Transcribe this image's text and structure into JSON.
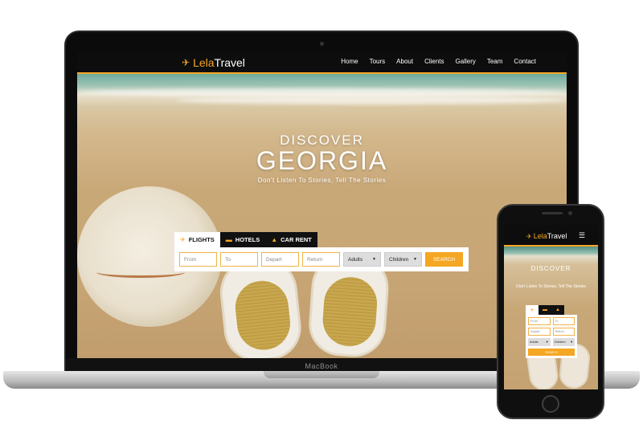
{
  "brand": {
    "logo_prefix": "Lela",
    "logo_suffix": "Travel"
  },
  "nav": {
    "items": [
      "Home",
      "Tours",
      "About",
      "Clients",
      "Gallery",
      "Team",
      "Contact"
    ]
  },
  "hero": {
    "line1": "DISCOVER",
    "line2": "GEORGIA",
    "tagline": "Don't Listen To Stories, Tell The Stories"
  },
  "search": {
    "tabs": [
      {
        "icon": "✈",
        "label": "FLIGHTS"
      },
      {
        "icon": "▬",
        "label": "HOTELS"
      },
      {
        "icon": "▲",
        "label": "CAR RENT"
      }
    ],
    "from_placeholder": "From",
    "to_placeholder": "To",
    "depart_placeholder": "Depart",
    "return_placeholder": "Return",
    "adults_value": "Adults",
    "children_value": "Children",
    "button_label": "SEARCH"
  },
  "device": {
    "laptop_label": "MacBook"
  },
  "phone": {
    "menu_icon": "☰"
  },
  "colors": {
    "accent": "#f5a623",
    "nav_bg": "#0d0d0d"
  }
}
